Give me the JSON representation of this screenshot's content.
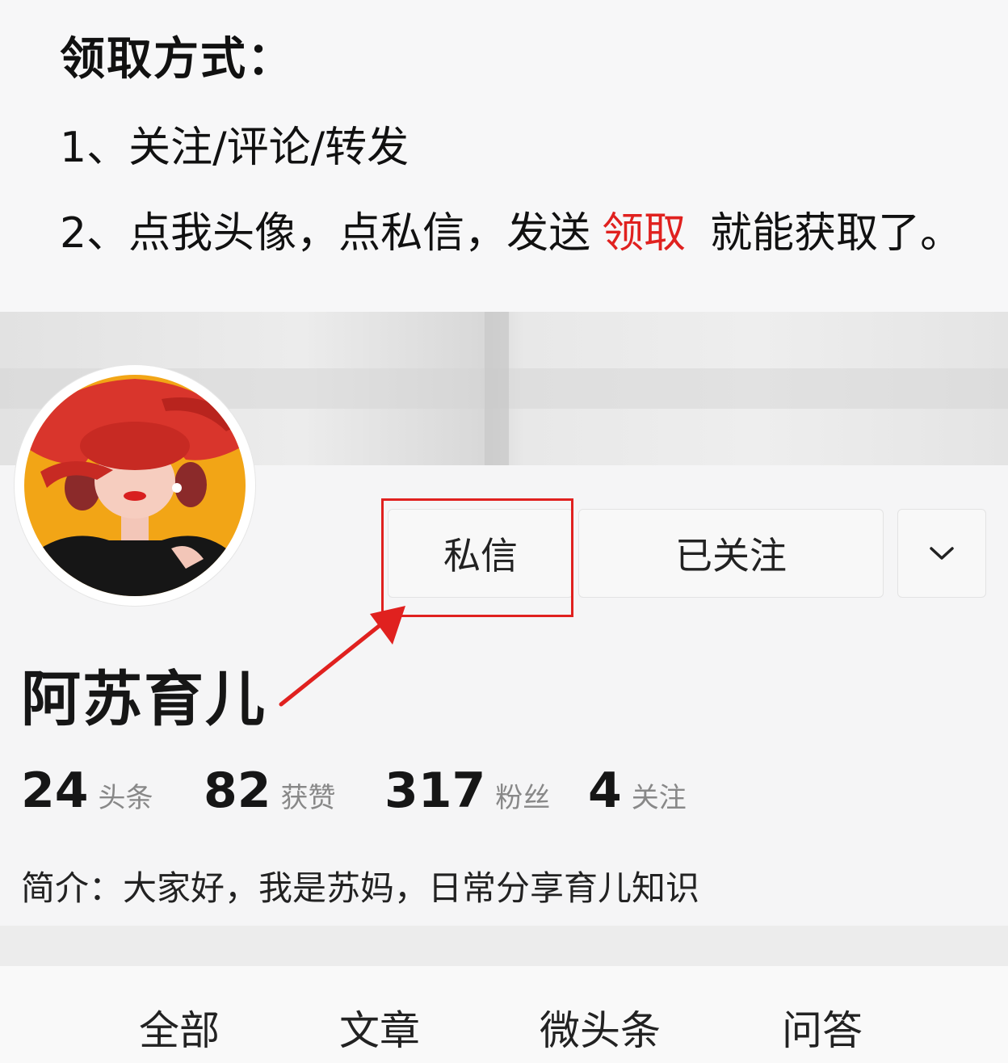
{
  "instructions": {
    "title": "领取方式：",
    "step1": "1、关注/评论/转发",
    "step2_prefix": "2、点我头像，点私信，发送",
    "step2_keyword": "领取",
    "step2_suffix": "就能获取了。"
  },
  "profile": {
    "name": "阿苏育儿",
    "buttons": {
      "message": "私信",
      "following": "已关注"
    },
    "stats": [
      {
        "value": "24",
        "label": "头条"
      },
      {
        "value": "82",
        "label": "获赞"
      },
      {
        "value": "317",
        "label": "粉丝"
      },
      {
        "value": "4",
        "label": "关注"
      }
    ],
    "bio": "简介：大家好，我是苏妈，日常分享育儿知识"
  },
  "tabs": [
    "全部",
    "文章",
    "微头条",
    "问答"
  ],
  "colors": {
    "highlight": "#e0211f",
    "keyword": "#e0211f"
  },
  "icons": {
    "more": "chevron-down-icon"
  }
}
